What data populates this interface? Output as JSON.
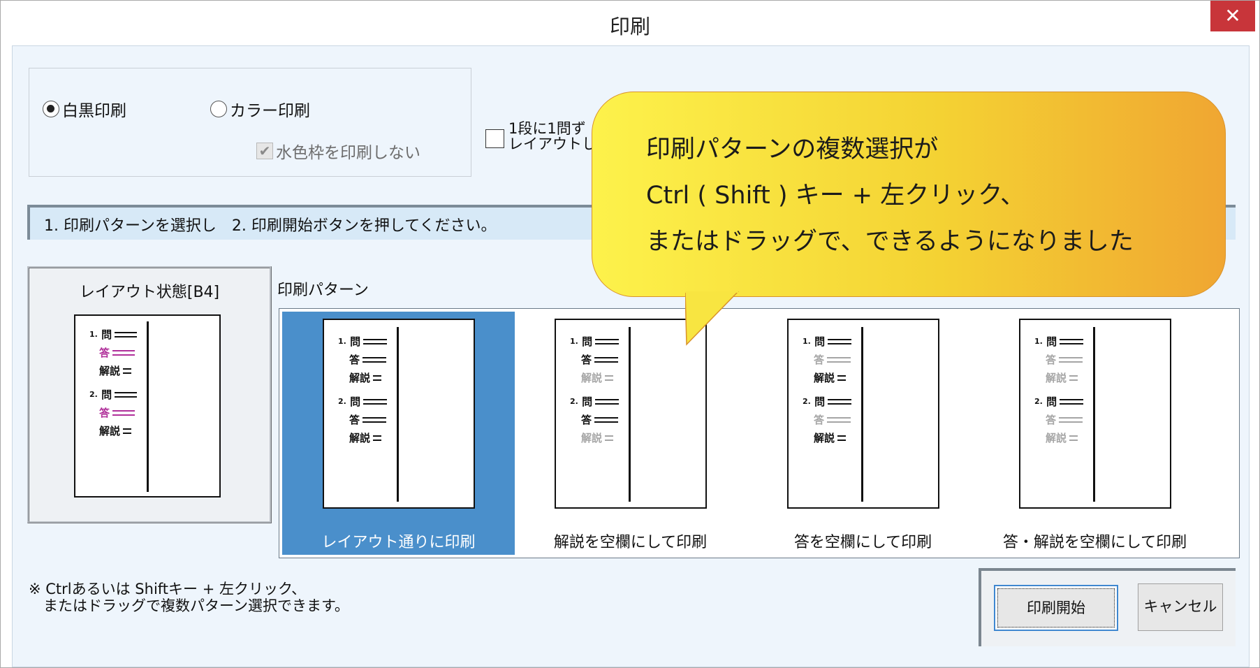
{
  "window": {
    "title": "印刷",
    "close_glyph": "✕"
  },
  "print_mode": {
    "mono_label": "白黒印刷",
    "mono_selected": true,
    "color_label": "カラー印刷",
    "color_selected": false,
    "no_frame_label": "水色枠を印刷しない",
    "no_frame_checked": true,
    "no_frame_enabled": false
  },
  "layout_option": {
    "label_line1": "1段に1問ず",
    "label_line2": "レイアウトし",
    "checked": false
  },
  "instruction": "1. 印刷パターンを選択し　2. 印刷開始ボタンを押してください。",
  "layout_preview": {
    "title": "レイアウト状態[B4]"
  },
  "preview_labels": {
    "num1": "1.",
    "num2": "2.",
    "question": "問",
    "answer": "答",
    "explanation": "解説"
  },
  "patterns": {
    "header": "印刷パターン",
    "items": [
      {
        "caption": "レイアウト通りに印刷",
        "selected": true
      },
      {
        "caption": "解説を空欄にして印刷",
        "selected": false
      },
      {
        "caption": "答を空欄にして印刷",
        "selected": false
      },
      {
        "caption": "答・解説を空欄にして印刷",
        "selected": false
      }
    ]
  },
  "note": "※ Ctrlあるいは Shiftキー + 左クリック、\n　またはドラッグで複数パターン選択できます。",
  "buttons": {
    "start": "印刷開始",
    "cancel": "キャンセル"
  },
  "callout": {
    "line1": "印刷パターンの複数選択が",
    "line2": "Ctrl ( Shift ) キー + 左クリック、",
    "line3": "またはドラッグで、できるようになりました"
  },
  "colors": {
    "selected_bg": "#4a8fcb",
    "close_bg": "#c8353a",
    "magenta": "#b0309a",
    "muted": "#a5a5a5"
  }
}
